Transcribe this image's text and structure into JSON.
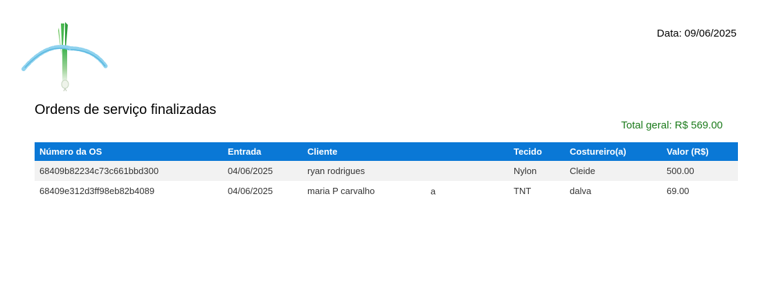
{
  "header": {
    "date_text": "Data: 09/06/2025"
  },
  "logo": {
    "alt": "Logo"
  },
  "report": {
    "title": "Ordens de serviço finalizadas",
    "total": "Total geral: R$ 569.00"
  },
  "table": {
    "columns": [
      "Número da OS",
      "Entrada",
      "Cliente",
      "Tecido",
      "Costureiro(a)",
      "Valor (R$)"
    ],
    "rows": [
      {
        "numero": "68409b82234c73c661bbd300",
        "entrada": "04/06/2025",
        "cliente": "ryan rodrigues",
        "obs": "",
        "tecido": "Nylon",
        "costureiro": "Cleide",
        "valor": "500.00"
      },
      {
        "numero": "68409e312d3ff98eb82b4089",
        "entrada": "04/06/2025",
        "cliente": "maria P carvalho",
        "obs": "a",
        "tecido": "TNT",
        "costureiro": "dalva",
        "valor": "69.00"
      }
    ]
  },
  "colors": {
    "header_bg": "#0a78d6",
    "total_text": "#1a7a1a",
    "row_stripe": "#f2f2f2"
  }
}
